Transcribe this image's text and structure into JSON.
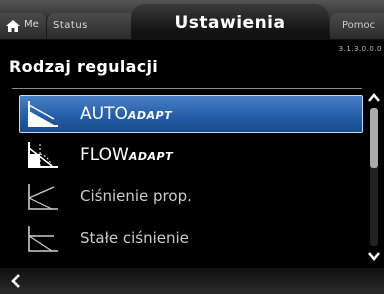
{
  "header": {
    "home_label": "Me",
    "status_label": "Status",
    "active_tab_label": "Ustawienia",
    "help_label": "Pomoc"
  },
  "page": {
    "title": "Rodzaj regulacji",
    "version": "3.1.3.0.0.0"
  },
  "list": {
    "items": [
      {
        "main": "AUTO",
        "suffix": "ADAPT",
        "icon": "autoadapt-curve-icon",
        "selected": true
      },
      {
        "main": "FLOW",
        "suffix": "ADAPT",
        "icon": "flowadapt-curve-icon",
        "selected": false
      },
      {
        "main": "Ciśnienie prop.",
        "icon": "proportional-pressure-icon",
        "selected": false
      },
      {
        "main": "Stałe ciśnienie",
        "icon": "constant-pressure-icon",
        "selected": false
      }
    ]
  },
  "scroll": {
    "position": 0.0
  },
  "colors": {
    "selection": "#2a63ad",
    "background": "#000000"
  }
}
